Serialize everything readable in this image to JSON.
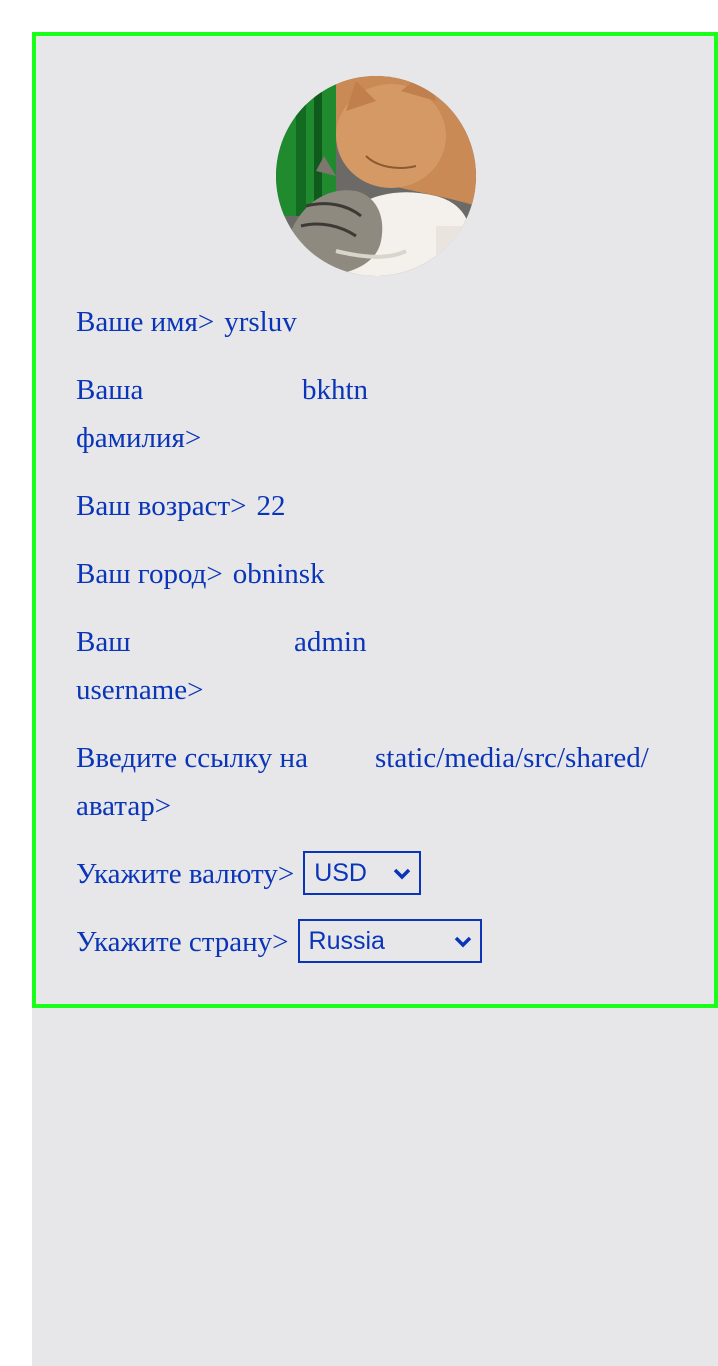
{
  "profile": {
    "avatar_icon": "cats-photo",
    "first_name": {
      "label": "Ваше имя>",
      "value": "yrsluv"
    },
    "last_name": {
      "label_line1": "Ваша",
      "label_line2": "фамилия>",
      "value": "bkhtn"
    },
    "age": {
      "label": "Ваш возраст>",
      "value": "22"
    },
    "city": {
      "label": "Ваш город>",
      "value": "obninsk"
    },
    "username": {
      "label_line1": "Ваш",
      "label_line2": "username>",
      "value": "admin"
    },
    "avatar_link": {
      "label_line1": "Введите ссылку на",
      "label_line2": "аватар>",
      "value": "static/media/src/shared/"
    },
    "currency": {
      "label": "Укажите валюту>",
      "selected": "USD"
    },
    "country": {
      "label": "Укажите страну>",
      "selected": "Russia"
    }
  },
  "colors": {
    "card_border": "#1aff1a",
    "text": "#0a35b8",
    "background": "#e7e7ea"
  }
}
